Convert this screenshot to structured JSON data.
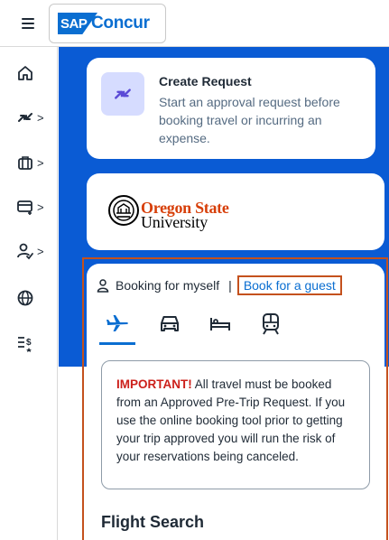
{
  "header": {
    "brand_sap": "SAP",
    "brand_name": "Concur"
  },
  "rail": {
    "items": [
      {
        "icon": "home-icon",
        "has_submenu": false
      },
      {
        "icon": "travel-request-icon",
        "has_submenu": true
      },
      {
        "icon": "luggage-icon",
        "has_submenu": true
      },
      {
        "icon": "expense-card-icon",
        "has_submenu": true
      },
      {
        "icon": "user-approve-icon",
        "has_submenu": true
      },
      {
        "icon": "globe-icon",
        "has_submenu": false
      },
      {
        "icon": "list-money-icon",
        "has_submenu": false
      }
    ],
    "chevron": ">"
  },
  "create_request": {
    "title": "Create Request",
    "description": "Start an approval request before booking travel or incurring an expense."
  },
  "org": {
    "name_line1": "Oregon State",
    "name_line2": "University",
    "colors": {
      "orange": "#d73f09",
      "black": "#000000"
    }
  },
  "booking": {
    "booking_for_myself": "Booking for myself",
    "separator": "|",
    "book_for_guest": "Book for a guest",
    "modes": [
      {
        "icon": "airplane-icon",
        "active": true
      },
      {
        "icon": "car-icon",
        "active": false
      },
      {
        "icon": "hotel-bed-icon",
        "active": false
      },
      {
        "icon": "train-icon",
        "active": false
      }
    ],
    "notice_label": "IMPORTANT!",
    "notice_text": "All travel must be booked from an Approved Pre-Trip Request. If you use the online booking tool prior to getting your trip approved you will run the risk of your reservations being canceled.",
    "flight_search_title": "Flight Search"
  },
  "colors": {
    "brand_blue": "#0a5bd4",
    "link_blue": "#0a6ed1",
    "highlight_outline": "#c4511d",
    "important_red": "#cc1f1a",
    "icon_tile": "#d6dcff"
  }
}
